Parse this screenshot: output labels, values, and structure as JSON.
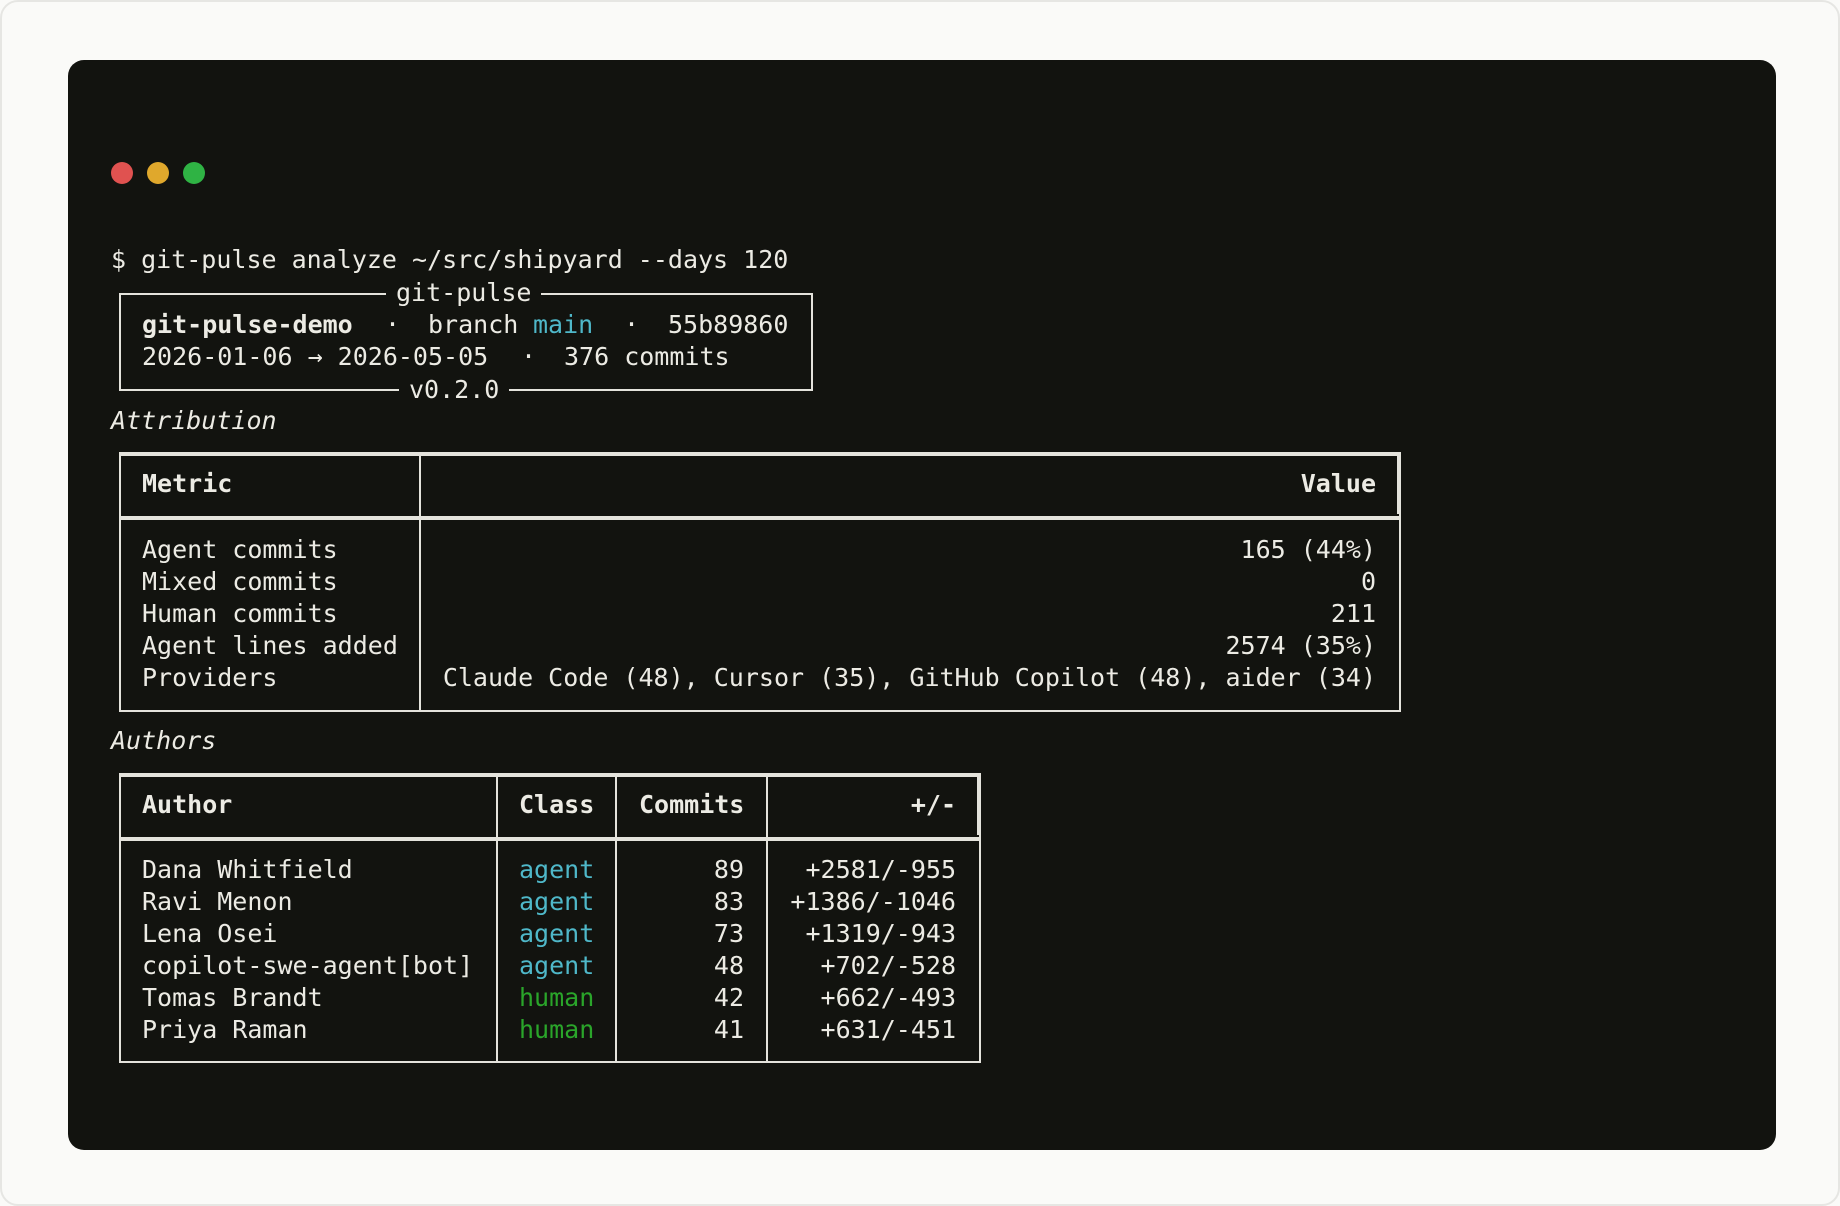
{
  "window": {
    "controls": [
      "close",
      "minimize",
      "maximize"
    ],
    "colors": {
      "close": "#e05250",
      "minimize": "#e0a82c",
      "maximize": "#2fb344",
      "background": "#12130f"
    }
  },
  "command": "$ git-pulse analyze ~/src/shipyard --days 120",
  "header_panel": {
    "title": "git-pulse",
    "repo": "git-pulse-demo",
    "sep": "·",
    "branch_label": "branch",
    "branch": "main",
    "commit": "55b89860",
    "date_range": "2026-01-06 → 2026-05-05",
    "commits": "376 commits",
    "version": "v0.2.0"
  },
  "attribution": {
    "section_title": "Attribution",
    "columns": [
      "Metric",
      "Value"
    ],
    "rows": [
      {
        "metric": "Agent commits",
        "value": "165 (44%)"
      },
      {
        "metric": "Mixed commits",
        "value": "0"
      },
      {
        "metric": "Human commits",
        "value": "211"
      },
      {
        "metric": "Agent lines added",
        "value": "2574 (35%)"
      },
      {
        "metric": "Providers",
        "value": "Claude Code (48), Cursor (35), GitHub Copilot (48), aider (34)"
      }
    ]
  },
  "authors": {
    "section_title": "Authors",
    "columns": [
      "Author",
      "Class",
      "Commits",
      "+/-"
    ],
    "rows": [
      {
        "author": "Dana Whitfield",
        "class": "agent",
        "commits": "89",
        "delta": "+2581/-955"
      },
      {
        "author": "Ravi Menon",
        "class": "agent",
        "commits": "83",
        "delta": "+1386/-1046"
      },
      {
        "author": "Lena Osei",
        "class": "agent",
        "commits": "73",
        "delta": "+1319/-943"
      },
      {
        "author": "copilot-swe-agent[bot]",
        "class": "agent",
        "commits": "48",
        "delta": "+702/-528"
      },
      {
        "author": "Tomas Brandt",
        "class": "human",
        "commits": "42",
        "delta": "+662/-493"
      },
      {
        "author": "Priya Raman",
        "class": "human",
        "commits": "41",
        "delta": "+631/-451"
      }
    ],
    "class_colors": {
      "agent": "#4fb8c9",
      "human": "#2aa52a"
    }
  }
}
